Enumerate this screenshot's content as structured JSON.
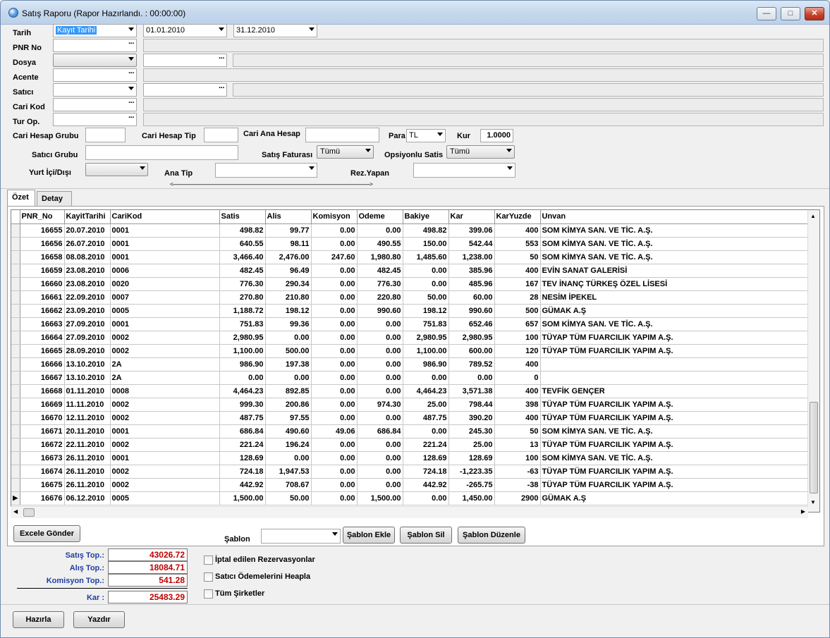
{
  "window": {
    "title": "Satış Raporu (Rapor Hazırlandı. : 00:00:00)",
    "btn_min": "—",
    "btn_max": "□",
    "btn_close": "✕"
  },
  "filters": {
    "tarih_label": "Tarih",
    "tarih_type": "Kayıt Tarihi",
    "date_from": "01.01.2010",
    "date_to": "31.12.2010",
    "pnr_label": "PNR No",
    "dosya_label": "Dosya",
    "acente_label": "Acente",
    "satici_label": "Satıcı",
    "carikod_label": "Cari Kod",
    "turop_label": "Tur Op.",
    "cari_hesap_grubu_label": "Cari Hesap Grubu",
    "cari_hesap_tip_label": "Cari Hesap Tip",
    "cari_ana_hesap_label": "Cari Ana Hesap",
    "para_label": "Para",
    "para_value": "TL",
    "kur_label": "Kur",
    "kur_value": "1.0000",
    "satici_grubu_label": "Satıcı Grubu",
    "satis_faturasi_label": "Satış Faturası",
    "satis_faturasi_value": "Tümü",
    "opsiyonlu_satis_label": "Opsiyonlu Satis",
    "opsiyonlu_satis_value": "Tümü",
    "yurt_ici_disi_label": "Yurt İçi/Dışı",
    "ana_tip_label": "Ana Tip",
    "rez_yapan_label": "Rez.Yapan",
    "splitter": "<------------------------------------------------------------------------------------------------------------------------------------------------------------------------>"
  },
  "tabs": [
    {
      "label": "Özet",
      "active": true
    },
    {
      "label": "Detay",
      "active": false
    }
  ],
  "grid": {
    "columns": [
      "PNR_No",
      "KayitTarihi",
      "CariKod",
      "Satis",
      "Alis",
      "Komisyon",
      "Odeme",
      "Bakiye",
      "Kar",
      "KarYuzde",
      "Unvan"
    ],
    "rows": [
      [
        "16655",
        "20.07.2010",
        "0001",
        "498.82",
        "99.77",
        "0.00",
        "0.00",
        "498.82",
        "399.06",
        "400",
        "SOM KİMYA SAN. VE TİC. A.Ş."
      ],
      [
        "16656",
        "26.07.2010",
        "0001",
        "640.55",
        "98.11",
        "0.00",
        "490.55",
        "150.00",
        "542.44",
        "553",
        "SOM KİMYA SAN. VE TİC. A.Ş."
      ],
      [
        "16658",
        "08.08.2010",
        "0001",
        "3,466.40",
        "2,476.00",
        "247.60",
        "1,980.80",
        "1,485.60",
        "1,238.00",
        "50",
        "SOM KİMYA SAN. VE TİC. A.Ş."
      ],
      [
        "16659",
        "23.08.2010",
        "0006",
        "482.45",
        "96.49",
        "0.00",
        "482.45",
        "0.00",
        "385.96",
        "400",
        "EVİN SANAT GALERİSİ"
      ],
      [
        "16660",
        "23.08.2010",
        "0020",
        "776.30",
        "290.34",
        "0.00",
        "776.30",
        "0.00",
        "485.96",
        "167",
        "TEV İNANÇ TÜRKEŞ ÖZEL LİSESİ"
      ],
      [
        "16661",
        "22.09.2010",
        "0007",
        "270.80",
        "210.80",
        "0.00",
        "220.80",
        "50.00",
        "60.00",
        "28",
        "NESİM İPEKEL"
      ],
      [
        "16662",
        "23.09.2010",
        "0005",
        "1,188.72",
        "198.12",
        "0.00",
        "990.60",
        "198.12",
        "990.60",
        "500",
        "GÜMAK A.Ş"
      ],
      [
        "16663",
        "27.09.2010",
        "0001",
        "751.83",
        "99.36",
        "0.00",
        "0.00",
        "751.83",
        "652.46",
        "657",
        "SOM KİMYA SAN. VE TİC. A.Ş."
      ],
      [
        "16664",
        "27.09.2010",
        "0002",
        "2,980.95",
        "0.00",
        "0.00",
        "0.00",
        "2,980.95",
        "2,980.95",
        "100",
        "TÜYAP TÜM FUARCILIK YAPIM A.Ş."
      ],
      [
        "16665",
        "28.09.2010",
        "0002",
        "1,100.00",
        "500.00",
        "0.00",
        "0.00",
        "1,100.00",
        "600.00",
        "120",
        "TÜYAP TÜM FUARCILIK YAPIM A.Ş."
      ],
      [
        "16666",
        "13.10.2010",
        "2A",
        "986.90",
        "197.38",
        "0.00",
        "0.00",
        "986.90",
        "789.52",
        "400",
        ""
      ],
      [
        "16667",
        "13.10.2010",
        "2A",
        "0.00",
        "0.00",
        "0.00",
        "0.00",
        "0.00",
        "0.00",
        "0",
        ""
      ],
      [
        "16668",
        "01.11.2010",
        "0008",
        "4,464.23",
        "892.85",
        "0.00",
        "0.00",
        "4,464.23",
        "3,571.38",
        "400",
        "TEVFİK GENÇER"
      ],
      [
        "16669",
        "11.11.2010",
        "0002",
        "999.30",
        "200.86",
        "0.00",
        "974.30",
        "25.00",
        "798.44",
        "398",
        "TÜYAP TÜM FUARCILIK YAPIM A.Ş."
      ],
      [
        "16670",
        "12.11.2010",
        "0002",
        "487.75",
        "97.55",
        "0.00",
        "0.00",
        "487.75",
        "390.20",
        "400",
        "TÜYAP TÜM FUARCILIK YAPIM A.Ş."
      ],
      [
        "16671",
        "20.11.2010",
        "0001",
        "686.84",
        "490.60",
        "49.06",
        "686.84",
        "0.00",
        "245.30",
        "50",
        "SOM KİMYA SAN. VE TİC. A.Ş."
      ],
      [
        "16672",
        "22.11.2010",
        "0002",
        "221.24",
        "196.24",
        "0.00",
        "0.00",
        "221.24",
        "25.00",
        "13",
        "TÜYAP TÜM FUARCILIK YAPIM A.Ş."
      ],
      [
        "16673",
        "26.11.2010",
        "0001",
        "128.69",
        "0.00",
        "0.00",
        "0.00",
        "128.69",
        "128.69",
        "100",
        "SOM KİMYA SAN. VE TİC. A.Ş."
      ],
      [
        "16674",
        "26.11.2010",
        "0002",
        "724.18",
        "1,947.53",
        "0.00",
        "0.00",
        "724.18",
        "-1,223.35",
        "-63",
        "TÜYAP TÜM FUARCILIK YAPIM A.Ş."
      ],
      [
        "16675",
        "26.11.2010",
        "0002",
        "442.92",
        "708.67",
        "0.00",
        "0.00",
        "442.92",
        "-265.75",
        "-38",
        "TÜYAP TÜM FUARCILIK YAPIM A.Ş."
      ],
      [
        "16676",
        "06.12.2010",
        "0005",
        "1,500.00",
        "50.00",
        "0.00",
        "1,500.00",
        "0.00",
        "1,450.00",
        "2900",
        "GÜMAK A.Ş"
      ]
    ],
    "current_row_marker": "▶"
  },
  "panel_buttons": {
    "excel": "Excele Gönder",
    "sablon_label": "Şablon",
    "sablon_ekle": "Şablon Ekle",
    "sablon_sil": "Şablon Sil",
    "sablon_duzenle": "Şablon Düzenle"
  },
  "totals": {
    "satis_label": "Satış Top.:",
    "satis_value": "43026.72",
    "alis_label": "Alış Top.:",
    "alis_value": "18084.71",
    "komisyon_label": "Komisyon Top.:",
    "komisyon_value": "541.28",
    "kar_label": "Kar :",
    "kar_value": "25483.29"
  },
  "options": {
    "iptal": "İptal edilen Rezervasyonlar",
    "satici_odeme": "Satıcı Ödemelerini Heapla",
    "tum_sirketler": "Tüm Şirketler"
  },
  "footer": {
    "hazirla": "Hazırla",
    "yazdir": "Yazdır"
  }
}
